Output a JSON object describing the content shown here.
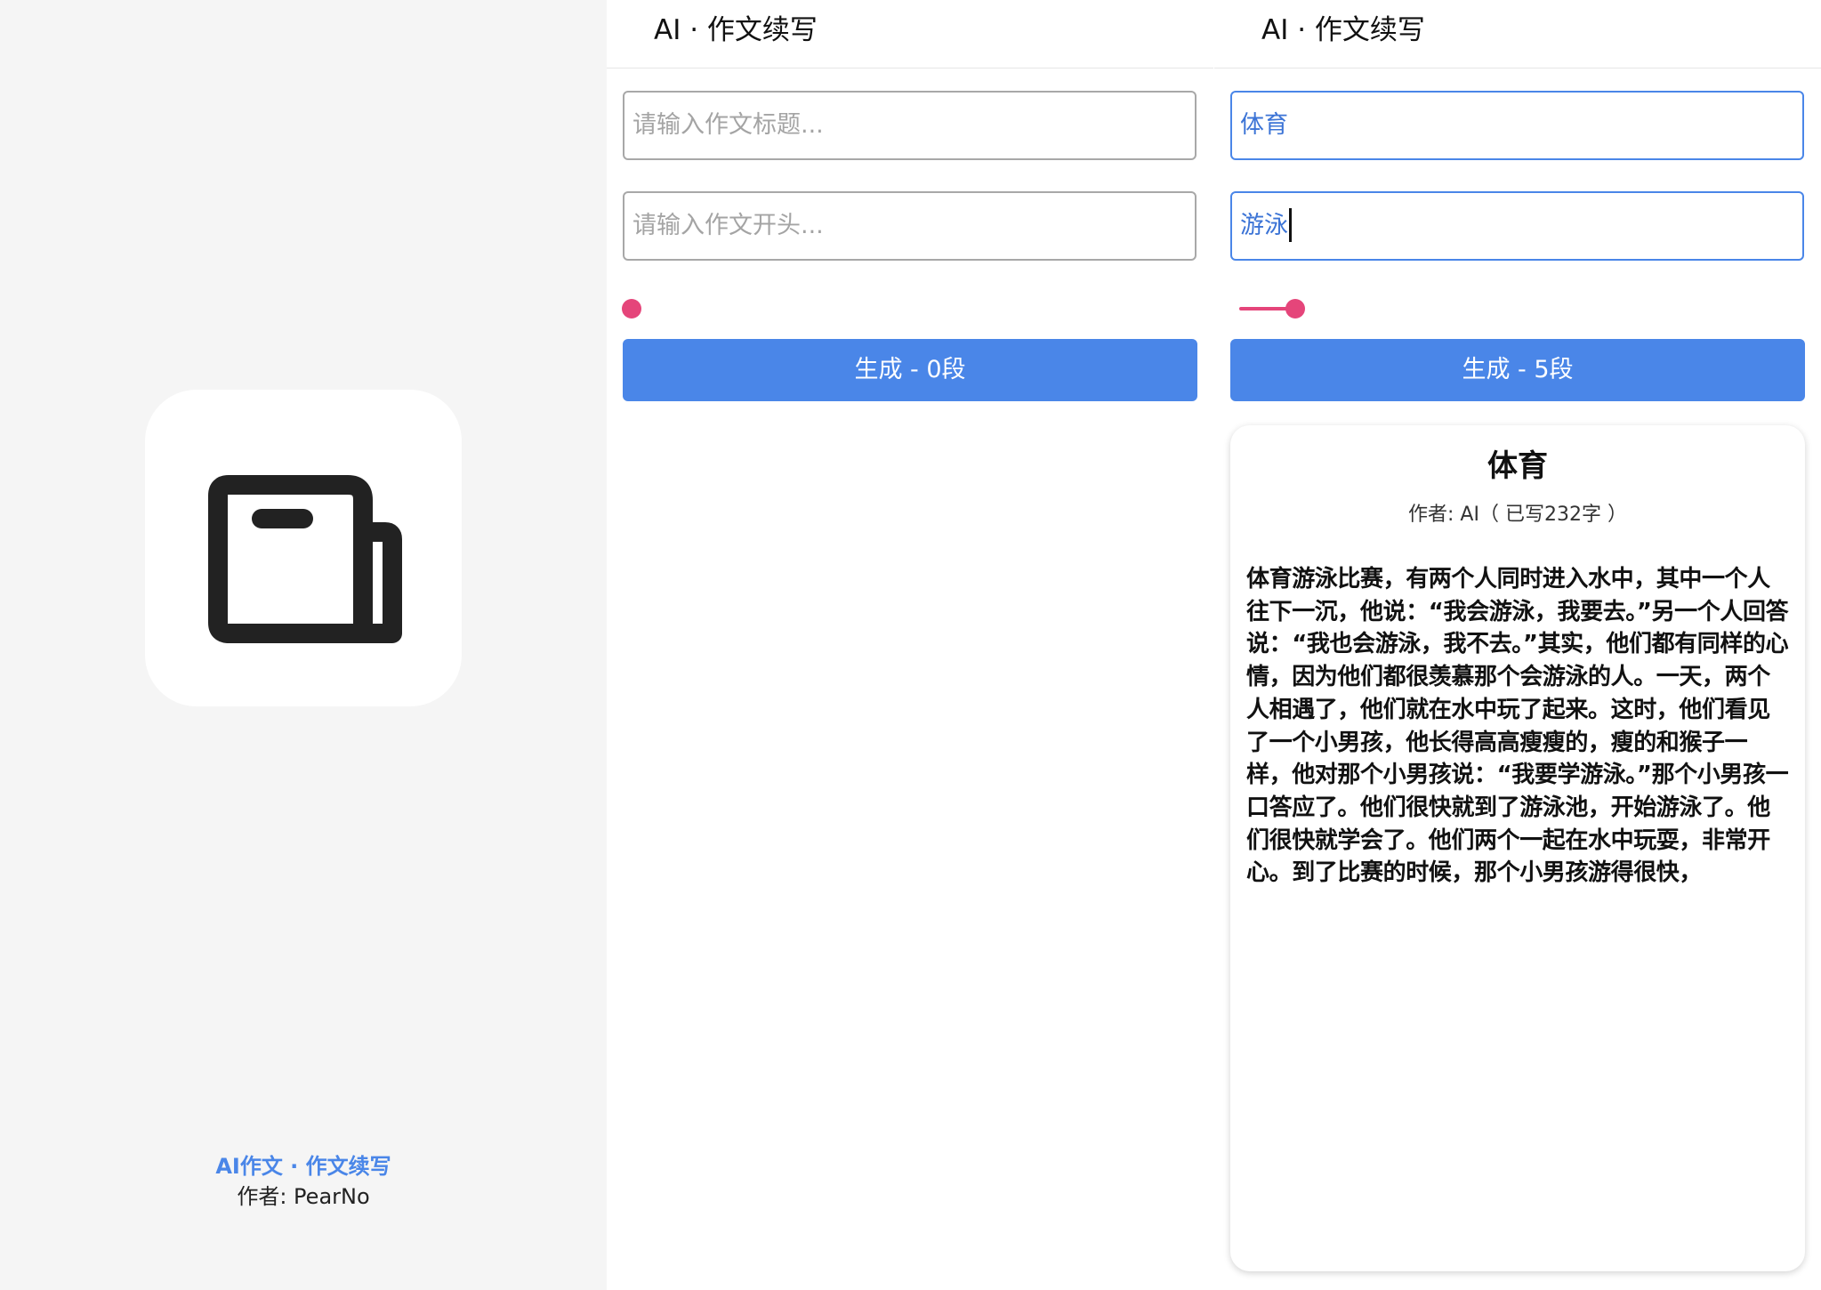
{
  "theme": {
    "accent": "#4a86e8",
    "slider_color": "#e5457a",
    "splash_background": "#f5f5f5"
  },
  "splash": {
    "icon": "book-icon",
    "title": "AI作文 · 作文续写",
    "author": "作者: PearNo"
  },
  "screen_empty": {
    "header_title": "AI · 作文续写",
    "title_input": {
      "value": "",
      "placeholder": "请输入作文标题..."
    },
    "opening_input": {
      "value": "",
      "placeholder": "请输入作文开头..."
    },
    "paragraph_slider": {
      "value": 0,
      "max": 50
    },
    "generate_button": "生成 - 0段"
  },
  "screen_result": {
    "header_title": "AI · 作文续写",
    "title_input": {
      "value": "体育",
      "placeholder": "请输入作文标题..."
    },
    "opening_input": {
      "value": "游泳",
      "placeholder": "请输入作文开头..."
    },
    "paragraph_slider": {
      "value": 5,
      "max": 50
    },
    "generate_button": "生成 - 5段",
    "essay": {
      "title": "体育",
      "meta": "作者: AI（ 已写232字 ）",
      "body": "体育游泳比赛，有两个人同时进入水中，其中一个人往下一沉，他说：“我会游泳，我要去。”另一个人回答说：“我也会游泳，我不去。”其实，他们都有同样的心情，因为他们都很羡慕那个会游泳的人。一天，两个人相遇了，他们就在水中玩了起来。这时，他们看见了一个小男孩，他长得高高瘦瘦的，瘦的和猴子一样，他对那个小男孩说：“我要学游泳。”那个小男孩一口答应了。他们很快就到了游泳池，开始游泳了。他们很快就学会了。他们两个一起在水中玩耍，非常开心。到了比赛的时候，那个小男孩游得很快，"
    }
  }
}
